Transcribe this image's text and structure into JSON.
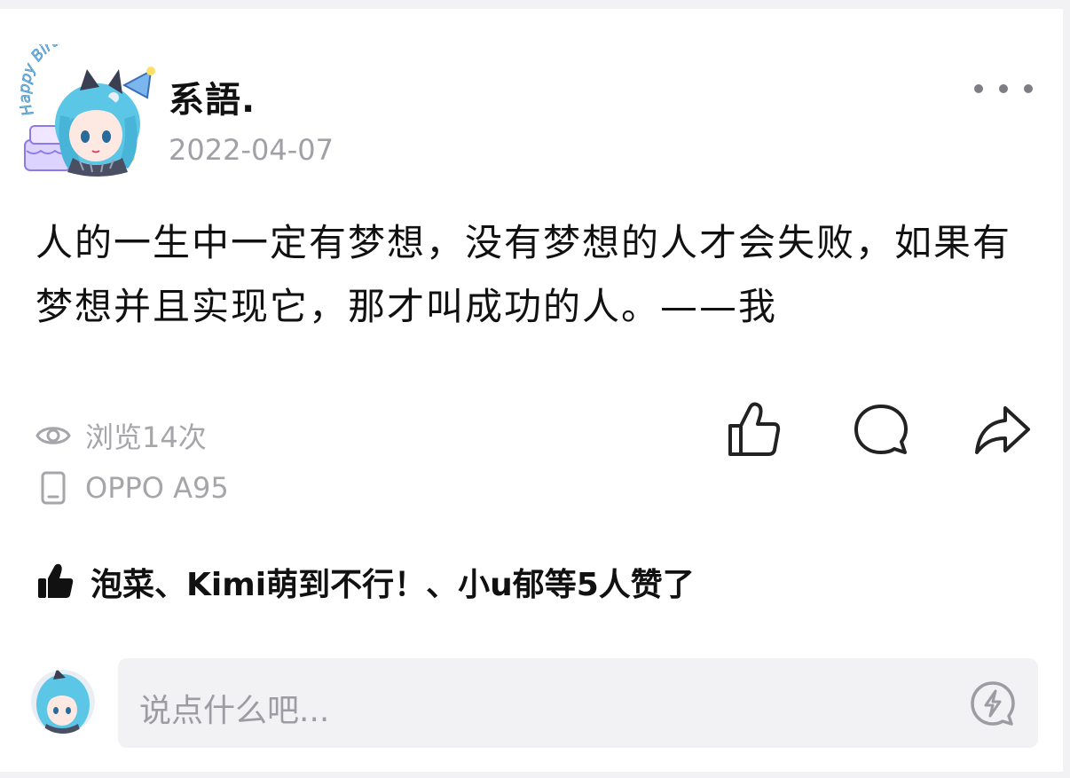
{
  "post": {
    "author": "系語.",
    "date": "2022-04-07",
    "content": "人的一生中一定有梦想，没有梦想的人才会失败，如果有梦想并且实现它，那才叫成功的人。——我",
    "views_text": "浏览14次",
    "device_text": "OPPO A95",
    "likes_text": "泡菜、Kimi萌到不行！、小u郁等5人赞了"
  },
  "avatar": {
    "badge_text": "Happy Birthday"
  },
  "comment": {
    "placeholder": "说点什么吧..."
  },
  "icons": {
    "more": "more-dots-icon",
    "views": "eye-icon",
    "device": "phone-icon",
    "like": "thumbs-up-icon",
    "comment": "comment-bubble-icon",
    "share": "share-arrow-icon",
    "likes": "thumbs-up-filled-icon",
    "emoji": "emoji-lightning-icon"
  },
  "colors": {
    "primary_text": "#111111",
    "secondary_text": "#a0a0a6",
    "background": "#ffffff",
    "input_bg": "#f2f2f5",
    "avatar_hair": "#5bc6e6"
  }
}
